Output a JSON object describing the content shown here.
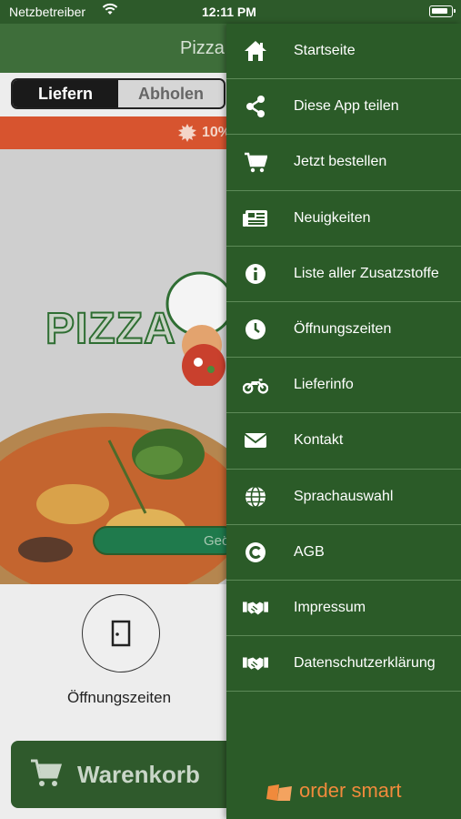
{
  "status_bar": {
    "carrier": "Netzbetreiber",
    "time": "12:11 PM"
  },
  "app": {
    "header_title": "Pizza",
    "tabs": [
      {
        "label": "Liefern",
        "active": true
      },
      {
        "label": "Abholen",
        "active": false
      }
    ],
    "promo_text": "10%",
    "hero": {
      "logo_text": "PIZZA",
      "pill_text": "Geö"
    },
    "opening_hours_label": "Öffnungszeiten",
    "cart_label": "Warenkorb"
  },
  "drawer": {
    "items": [
      {
        "label": "Startseite",
        "icon": "home-icon"
      },
      {
        "label": "Diese App teilen",
        "icon": "share-icon"
      },
      {
        "label": "Jetzt bestellen",
        "icon": "cart-icon"
      },
      {
        "label": "Neuigkeiten",
        "icon": "newspaper-icon"
      },
      {
        "label": "Liste aller Zusatzstoffe",
        "icon": "info-icon"
      },
      {
        "label": "Öffnungszeiten",
        "icon": "clock-icon"
      },
      {
        "label": "Lieferinfo",
        "icon": "motorcycle-icon"
      },
      {
        "label": "Kontakt",
        "icon": "envelope-icon"
      },
      {
        "label": "Sprachauswahl",
        "icon": "globe-icon"
      },
      {
        "label": "AGB",
        "icon": "copyright-icon"
      },
      {
        "label": "Impressum",
        "icon": "handshake-icon"
      },
      {
        "label": "Datenschutzerklärung",
        "icon": "handshake-icon"
      }
    ],
    "brand": "order smart"
  },
  "colors": {
    "drawer_bg": "#2b5b28",
    "header_bg": "#3e6e3a",
    "promo_bg": "#d7542f",
    "brand_orange": "#f08a3c"
  }
}
